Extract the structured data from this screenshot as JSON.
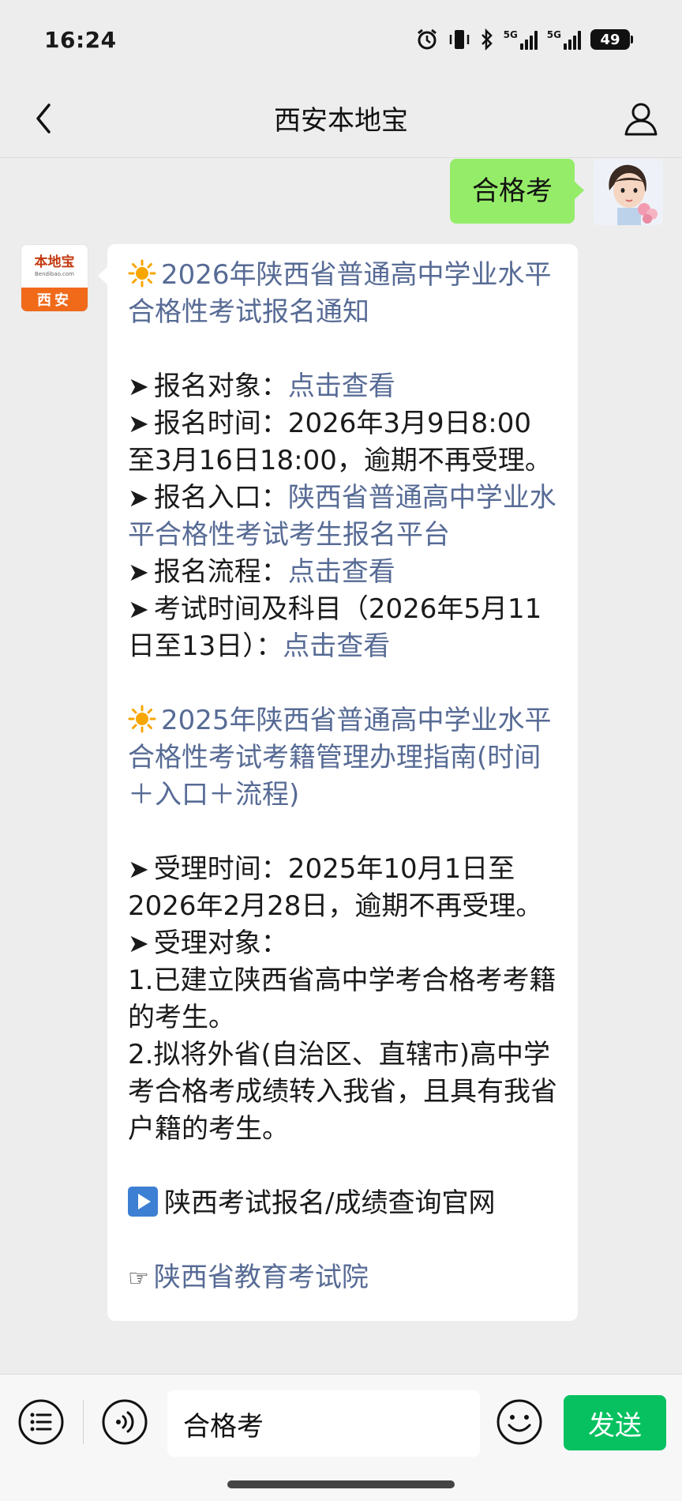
{
  "status_bar": {
    "time": "16:24",
    "network_1": "5G",
    "network_2": "5G",
    "battery": "49"
  },
  "nav": {
    "title": "西安本地宝"
  },
  "outgoing_message": {
    "text": "合格考"
  },
  "bot_avatar": {
    "brand": "本地宝",
    "url": "Bendibao.com",
    "city": "西安"
  },
  "reply": {
    "s1_title": "2026年陕西省普通高中学业水平合格性考试报名通知",
    "s1_items": [
      {
        "label": "报名对象：",
        "link": "点击查看"
      },
      {
        "label": "报名时间：2026年3月9日8:00至3月16日18:00，逾期不再受理。"
      },
      {
        "label": "报名入口：",
        "link": "陕西省普通高中学业水平合格性考试考生报名平台"
      },
      {
        "label": "报名流程：",
        "link": "点击查看"
      },
      {
        "label": "考试时间及科目（2026年5月11日至13日）：",
        "link": "点击查看"
      }
    ],
    "s2_title": "2025年陕西省普通高中学业水平合格性考试考籍管理办理指南(时间＋入口＋流程)",
    "s2_items": [
      {
        "label": "受理时间：2025年10月1日至2026年2月28日，逾期不再受理。"
      },
      {
        "label": "受理对象："
      }
    ],
    "s2_list": [
      "1.已建立陕西省高中学考合格考考籍的考生。",
      "2.拟将外省(自治区、直辖市)高中学考合格考成绩转入我省，且具有我省户籍的考生。"
    ],
    "official_site": "陕西考试报名/成绩查询官网",
    "exam_institute": "陕西省教育考试院"
  },
  "input_bar": {
    "text": "合格考",
    "send_label": "发送"
  },
  "icons": {
    "back": "chevron-left-icon",
    "profile": "person-icon",
    "alarm": "alarm-icon",
    "vibrate": "vibrate-icon",
    "bluetooth": "bluetooth-icon",
    "menu": "list-icon",
    "voice": "voice-icon",
    "emoji": "emoji-icon"
  },
  "colors": {
    "outgoing_bubble": "#95ec69",
    "link": "#576b95",
    "send_button": "#07c160",
    "background": "#ededed"
  }
}
